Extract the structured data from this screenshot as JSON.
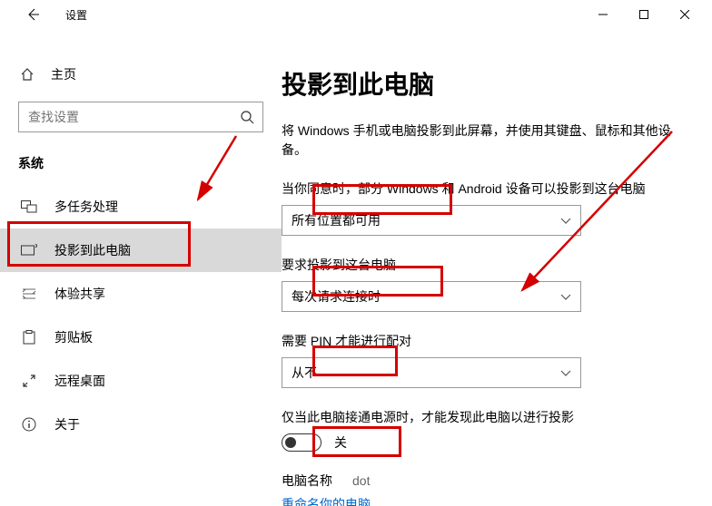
{
  "titlebar": {
    "title": "设置"
  },
  "sidebar": {
    "home": "主页",
    "search_placeholder": "查找设置",
    "section": "系统",
    "items": [
      {
        "label": "多任务处理"
      },
      {
        "label": "投影到此电脑"
      },
      {
        "label": "体验共享"
      },
      {
        "label": "剪贴板"
      },
      {
        "label": "远程桌面"
      },
      {
        "label": "关于"
      }
    ]
  },
  "main": {
    "heading": "投影到此电脑",
    "description": "将 Windows 手机或电脑投影到此屏幕，并使用其键盘、鼠标和其他设备。",
    "settings": [
      {
        "label": "当你同意时，部分 Windows 和 Android 设备可以投影到这台电脑",
        "value": "所有位置都可用"
      },
      {
        "label": "要求投影到这台电脑",
        "value": "每次请求连接时"
      },
      {
        "label": "需要 PIN 才能进行配对",
        "value": "从不"
      }
    ],
    "toggle": {
      "label": "仅当此电脑接通电源时，才能发现此电脑以进行投影",
      "value": "关"
    },
    "pc_name_label": "电脑名称",
    "pc_name_value": "dot",
    "rename_link": "重命名你的电脑"
  }
}
